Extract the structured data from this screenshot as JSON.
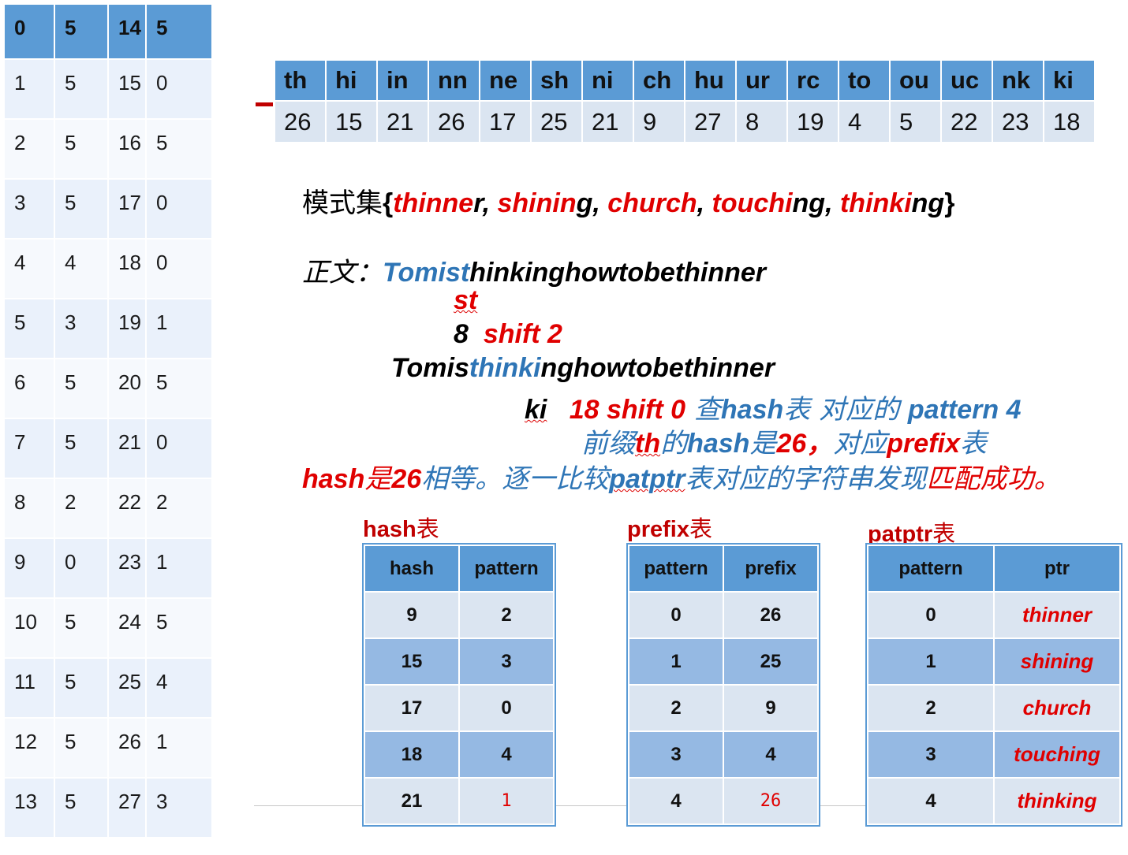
{
  "shift_table": {
    "header": [
      "0",
      "5",
      "14",
      "5"
    ],
    "rows": [
      [
        "1",
        "5",
        "15",
        "0"
      ],
      [
        "2",
        "5",
        "16",
        "5"
      ],
      [
        "3",
        "5",
        "17",
        "0"
      ],
      [
        "4",
        "4",
        "18",
        "0"
      ],
      [
        "5",
        "3",
        "19",
        "1"
      ],
      [
        "6",
        "5",
        "20",
        "5"
      ],
      [
        "7",
        "5",
        "21",
        "0"
      ],
      [
        "8",
        "2",
        "22",
        "2"
      ],
      [
        "9",
        "0",
        "23",
        "1"
      ],
      [
        "10",
        "5",
        "24",
        "5"
      ],
      [
        "11",
        "5",
        "25",
        "4"
      ],
      [
        "12",
        "5",
        "26",
        "1"
      ],
      [
        "13",
        "5",
        "27",
        "3"
      ]
    ]
  },
  "prefix_hash_table": {
    "prefixes": [
      "th",
      "hi",
      "in",
      "nn",
      "ne",
      "sh",
      "ni",
      "ch",
      "hu",
      "ur",
      "rc",
      "to",
      "ou",
      "uc",
      "nk",
      "ki"
    ],
    "hashes": [
      "26",
      "15",
      "21",
      "26",
      "17",
      "25",
      "21",
      "9",
      "27",
      "8",
      "19",
      "4",
      "5",
      "22",
      "23",
      "18"
    ]
  },
  "text": {
    "pattern_set_label": "模式集",
    "brace_open": "{",
    "p1_red": "thinne",
    "p1_black": "r",
    "sep": ", ",
    "p2_red": "shinin",
    "p2_black": "g",
    "p3_red": "church",
    "p4_red": "touchi",
    "p4_black": "ng",
    "p5_red": "thinki",
    "p5_black": "ng",
    "brace_close": "}",
    "text_label": "正文：",
    "t1_blue": "Tomist",
    "t1_black": "hinkinghowtobethinner",
    "st": "st",
    "shift_num": "8",
    "shift2": "shift 2",
    "t2_black1": "Tomis",
    "t2_blue": "thinki",
    "t2_black2": "nghowtobethinner",
    "ki": "ki",
    "ki_shift": "18  shift 0",
    "ki_lookup_cjk": " 查",
    "ki_hash": "hash",
    "ki_table_cjk": "表 对应的 ",
    "ki_pattern": "pattern 4",
    "prefix_cjk1": "前缀",
    "prefix_th": "th",
    "prefix_cjk2": "的",
    "prefix_hash": "hash",
    "prefix_cjk3": "是",
    "prefix_26": "26，",
    "prefix_cjk4": "对应",
    "prefix_word": "prefix",
    "prefix_cjk5": "表",
    "last_hash": "hash",
    "last_cjk1": "是",
    "last_26": "26",
    "last_cjk2": "相等。逐一比较",
    "last_patptr": "patptr",
    "last_cjk3": "表对应的字符串发现",
    "last_cjk4": "匹配成功。"
  },
  "hash_table": {
    "title_latin": "hash",
    "title_cjk": "表",
    "headers": [
      "hash",
      "pattern"
    ],
    "rows": [
      [
        "9",
        "2"
      ],
      [
        "15",
        "3"
      ],
      [
        "17",
        "0"
      ],
      [
        "18",
        "4"
      ],
      [
        "21",
        "1"
      ]
    ]
  },
  "prefix_table": {
    "title_latin": "prefix",
    "title_cjk": "表",
    "headers": [
      "pattern",
      "prefix"
    ],
    "rows": [
      [
        "0",
        "26"
      ],
      [
        "1",
        "25"
      ],
      [
        "2",
        "9"
      ],
      [
        "3",
        "4"
      ],
      [
        "4",
        "26"
      ]
    ]
  },
  "patptr_table": {
    "title_latin": "patptr",
    "title_cjk": "表",
    "headers": [
      "pattern",
      "ptr"
    ],
    "rows": [
      [
        "0",
        "thinner"
      ],
      [
        "1",
        "shining"
      ],
      [
        "2",
        "church"
      ],
      [
        "3",
        "touching"
      ],
      [
        "4",
        "thinking"
      ]
    ]
  }
}
